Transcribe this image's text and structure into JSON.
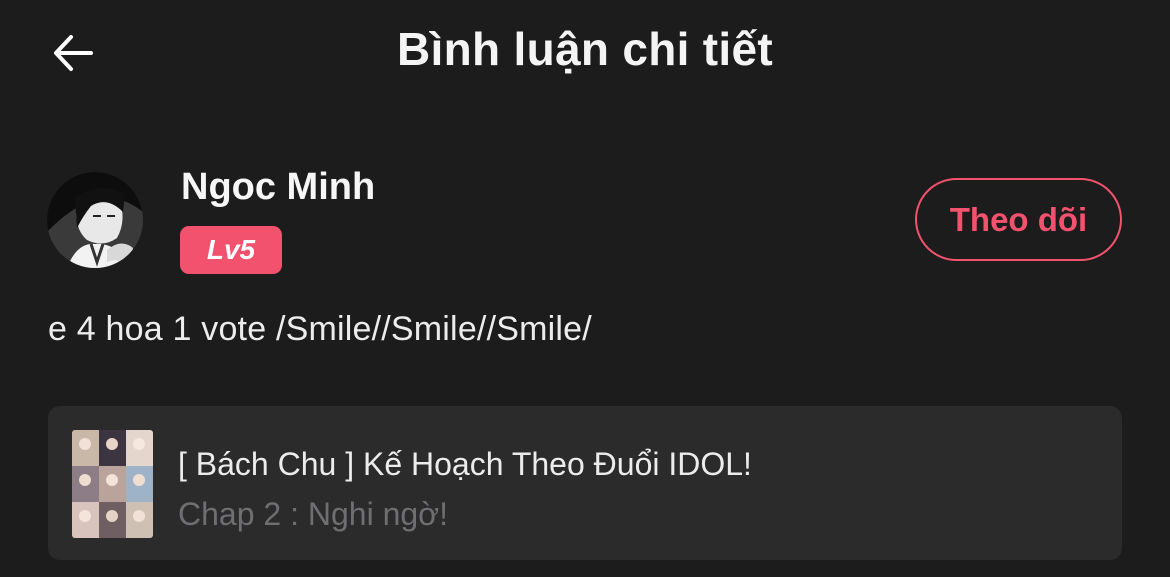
{
  "header": {
    "title": "Bình luận chi tiết",
    "back_icon": "arrow-left-icon"
  },
  "author": {
    "name": "Ngoc Minh",
    "level": "Lv5",
    "avatar": "manga-character-avatar",
    "follow_label": "Theo dõi"
  },
  "comment": {
    "text": "e 4 hoa 1 vote /Smile//Smile//Smile/"
  },
  "story": {
    "title": "[ Bách Chu ] Kế Hoạch Theo Đuổi IDOL!",
    "chapter": "Chap 2 : Nghi ngờ!",
    "cover": "photo-collage-cover"
  },
  "colors": {
    "background": "#1c1c1d",
    "accent": "#f2526d",
    "card": "#2b2b2c",
    "muted_text": "#6f6f72"
  }
}
